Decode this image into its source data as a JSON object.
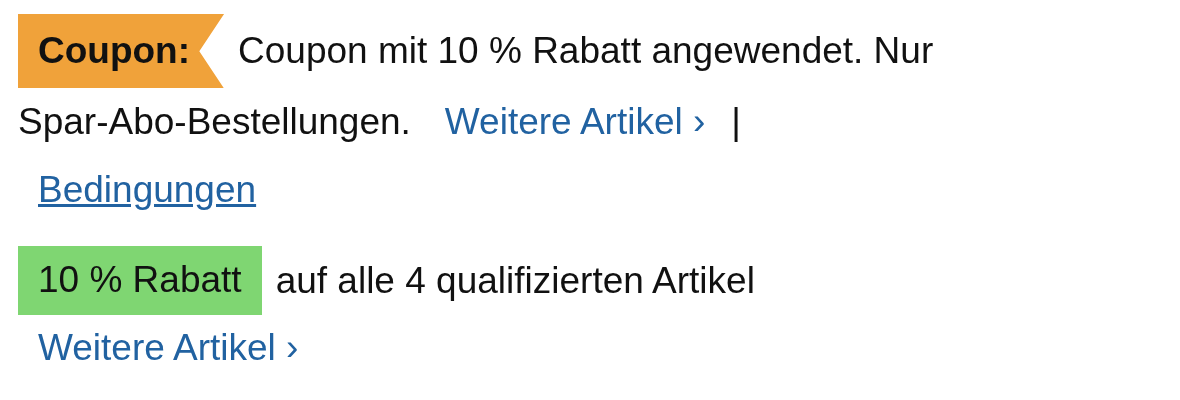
{
  "coupon": {
    "badge": "Coupon:",
    "message_lines": [
      "Coupon mit 10 % Rabatt angewendet. Nur",
      "Spar-Abo-Bestellungen."
    ],
    "more_link": "Weitere Artikel ›",
    "separator": "|",
    "terms_link": "Bedingungen"
  },
  "discount": {
    "badge": "10 % Rabatt",
    "message": "auf alle 4 qualifizierten Artikel",
    "more_link": "Weitere Artikel ›"
  }
}
